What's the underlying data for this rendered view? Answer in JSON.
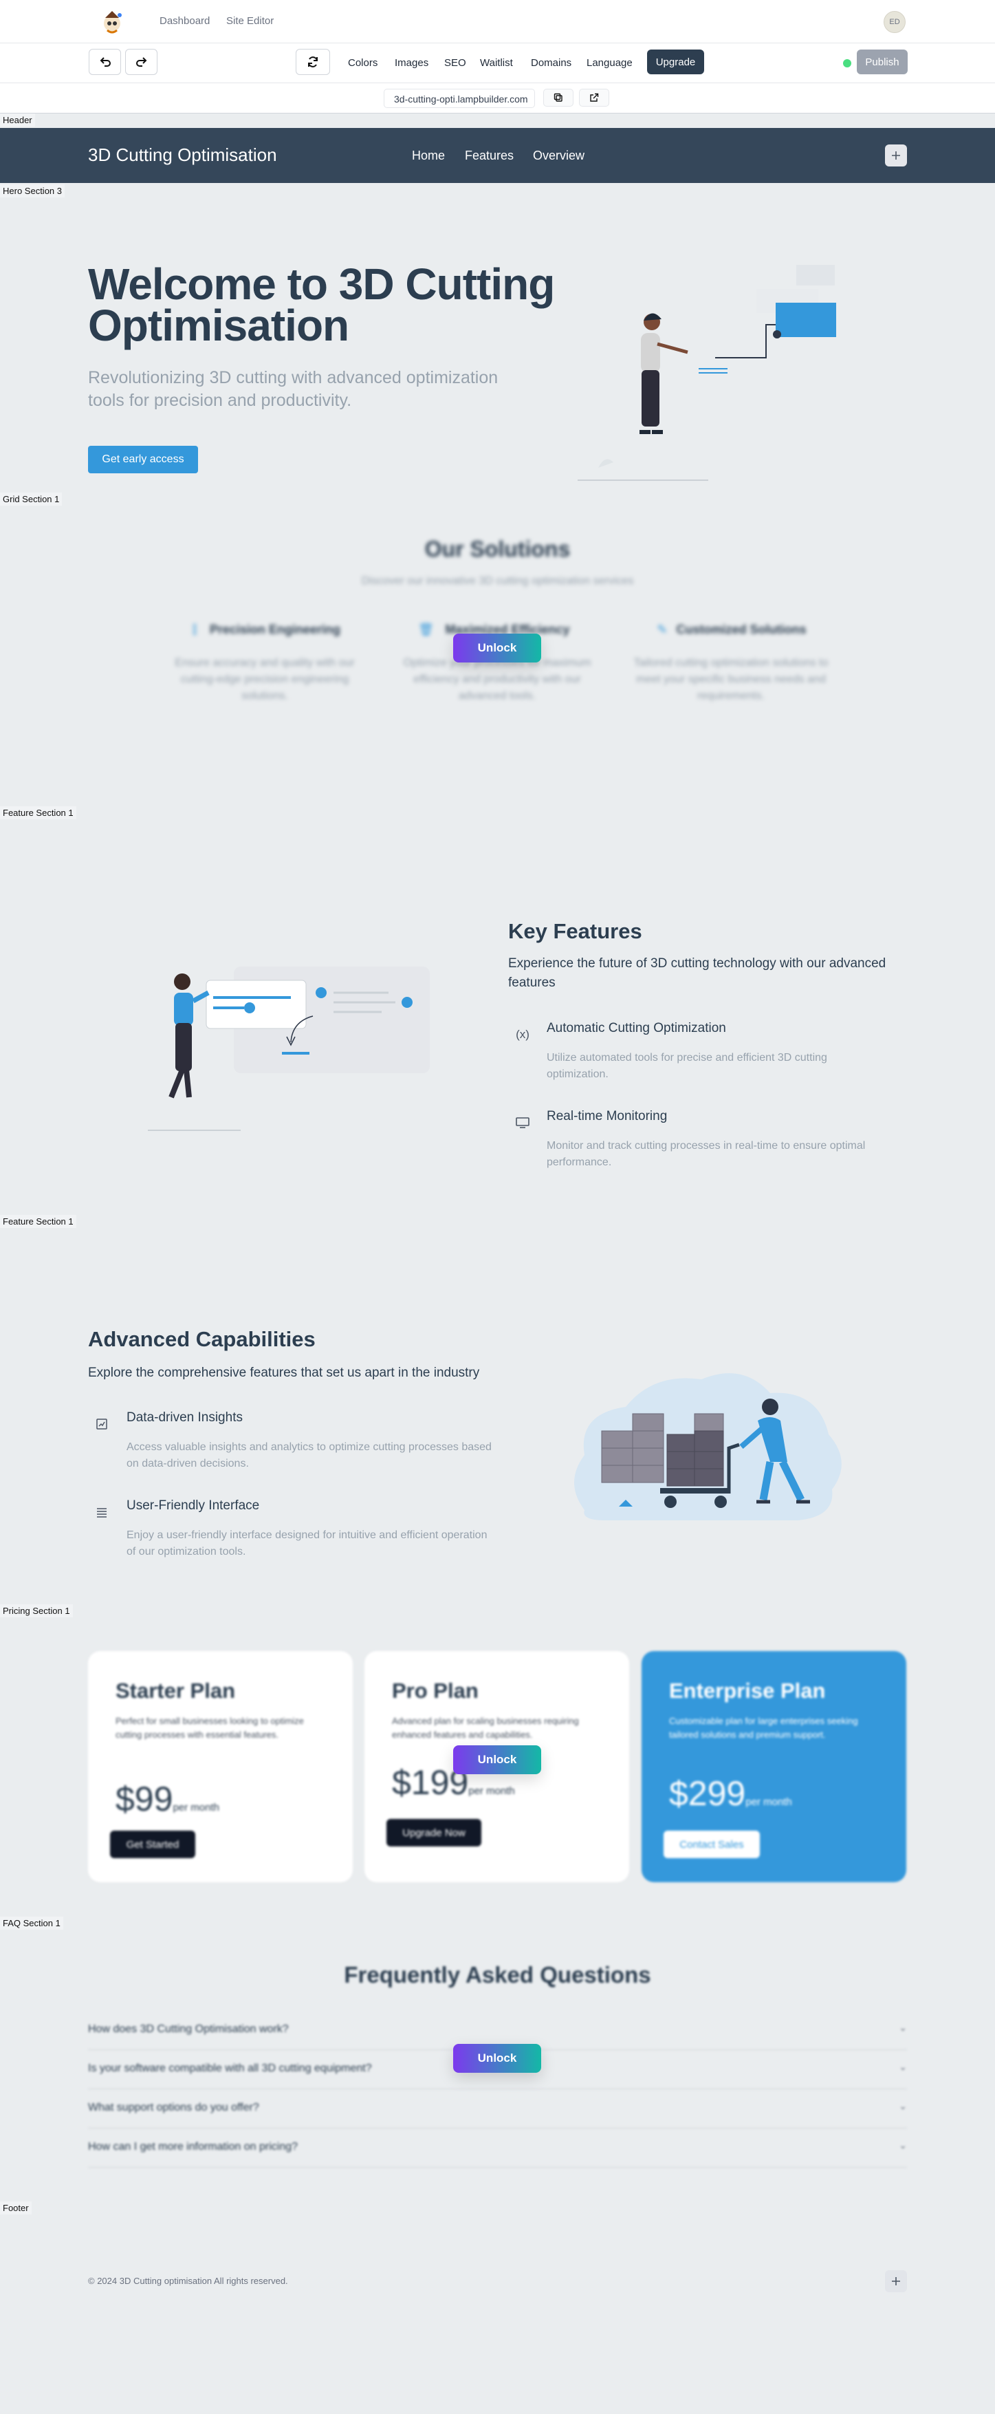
{
  "editor": {
    "nav": {
      "dashboard": "Dashboard",
      "site_editor": "Site Editor",
      "avatar_initials": "ED"
    },
    "toolbar": {
      "links": [
        "Colors",
        "Images",
        "SEO",
        "Waitlist",
        "Domains",
        "Language"
      ],
      "upgrade": "Upgrade",
      "publish": "Publish"
    },
    "url": "3d-cutting-opti.lampbuilder.com"
  },
  "section_tags": {
    "header": "Header",
    "hero": "Hero Section 3",
    "grid": "Grid Section 1",
    "feature1": "Feature Section 1",
    "feature2": "Feature Section 1",
    "pricing": "Pricing Section 1",
    "faq": "FAQ Section 1",
    "footer": "Footer"
  },
  "site": {
    "title": "3D Cutting Optimisation",
    "nav": [
      "Home",
      "Features",
      "Overview"
    ]
  },
  "hero": {
    "title": "Welcome to 3D Cutting Optimisation",
    "subtitle": "Revolutionizing 3D cutting with advanced optimization tools for precision and productivity.",
    "cta": "Get early access"
  },
  "unlock_label": "Unlock",
  "grid": {
    "title": "Our Solutions",
    "subtitle": "Discover our innovative 3D cutting optimization services",
    "items": [
      {
        "title": "Precision Engineering",
        "text": "Ensure accuracy and quality with our cutting-edge precision engineering solutions.",
        "icon": "ruler-icon"
      },
      {
        "title": "Maximized Efficiency",
        "text": "Optimize your processes for maximum efficiency and productivity with our advanced tools.",
        "icon": "trash-icon"
      },
      {
        "title": "Customized Solutions",
        "text": "Tailored cutting optimization solutions to meet your specific business needs and requirements.",
        "icon": "pencil-icon"
      }
    ]
  },
  "features1": {
    "title": "Key Features",
    "subtitle": "Experience the future of 3D cutting technology with our advanced features",
    "items": [
      {
        "title": "Automatic Cutting Optimization",
        "text": "Utilize automated tools for precise and efficient 3D cutting optimization.",
        "icon": "variable-icon"
      },
      {
        "title": "Real-time Monitoring",
        "text": "Monitor and track cutting processes in real-time to ensure optimal performance.",
        "icon": "monitor-icon"
      }
    ]
  },
  "features2": {
    "title": "Advanced Capabilities",
    "subtitle": "Explore the comprehensive features that set us apart in the industry",
    "items": [
      {
        "title": "Data-driven Insights",
        "text": "Access valuable insights and analytics to optimize cutting processes based on data-driven decisions.",
        "icon": "chart-icon"
      },
      {
        "title": "User-Friendly Interface",
        "text": "Enjoy a user-friendly interface designed for intuitive and efficient operation of our optimization tools.",
        "icon": "list-icon"
      }
    ]
  },
  "pricing": {
    "plans": [
      {
        "name": "Starter Plan",
        "text": "Perfect for small businesses looking to optimize cutting processes with essential features.",
        "price": "$99",
        "per": "per month",
        "cta": "Get Started"
      },
      {
        "name": "Pro Plan",
        "text": "Advanced plan for scaling businesses requiring enhanced features and capabilities.",
        "price": "$199",
        "per": "per month",
        "cta": "Upgrade Now"
      },
      {
        "name": "Enterprise Plan",
        "text": "Customizable plan for large enterprises seeking tailored solutions and premium support.",
        "price": "$299",
        "per": "per month",
        "cta": "Contact Sales"
      }
    ]
  },
  "faq": {
    "title": "Frequently Asked Questions",
    "questions": [
      "How does 3D Cutting Optimisation work?",
      "Is your software compatible with all 3D cutting equipment?",
      "What support options do you offer?",
      "How can I get more information on pricing?"
    ]
  },
  "footer": {
    "copyright": "© 2024 3D Cutting optimisation All rights reserved."
  },
  "colors": {
    "brand_dark": "#35475a",
    "accent": "#3498db",
    "text": "#2c3e50",
    "muted": "#97a2ad"
  }
}
